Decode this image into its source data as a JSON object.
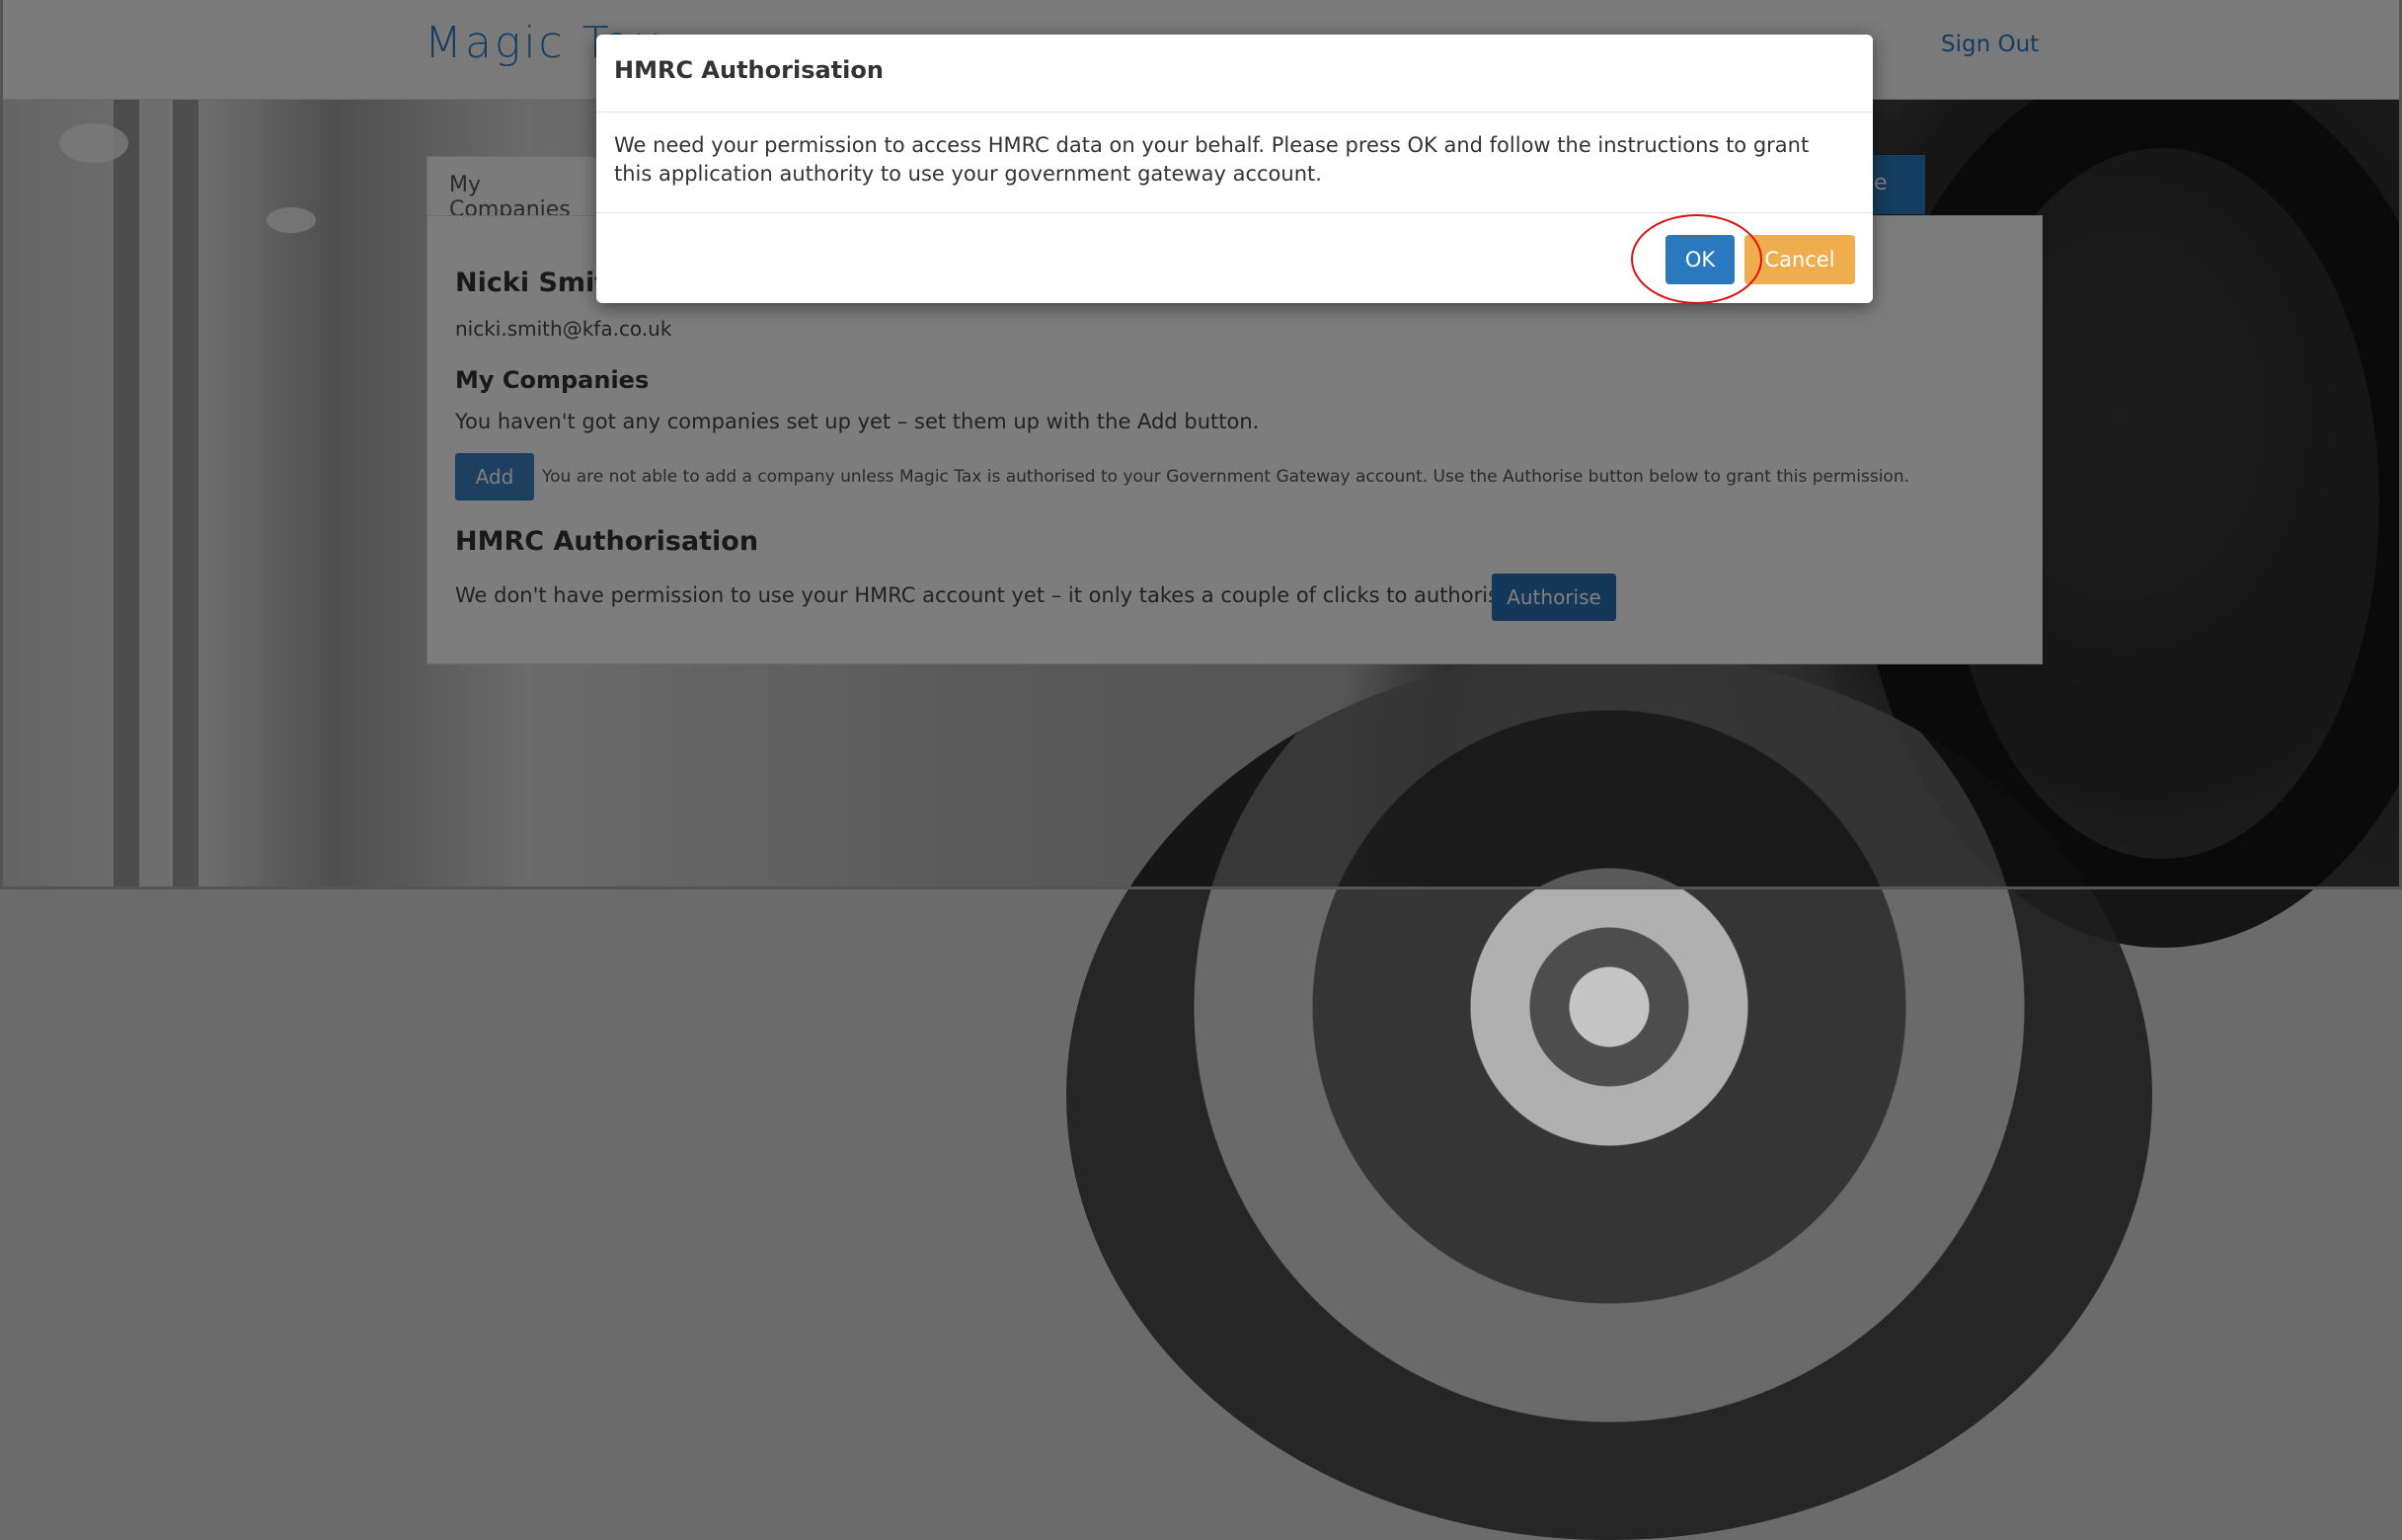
{
  "header": {
    "brand": "Magic Tax",
    "sign_out": "Sign Out"
  },
  "tabs": {
    "my_companies": "My Companies",
    "partial_blue_tab": "nce"
  },
  "profile": {
    "name": "Nicki Smith",
    "email": "nicki.smith@kfa.co.uk"
  },
  "companies": {
    "heading": "My Companies",
    "empty_text": "You haven't got any companies set up yet – set them up with the Add button.",
    "add_label": "Add",
    "add_note": "You are not able to add a company unless Magic Tax is authorised to your Government Gateway account. Use the Authorise button below to grant this permission."
  },
  "hmrc": {
    "heading": "HMRC Authorisation",
    "text": "We don't have permission to use your HMRC account yet – it only takes a couple of clicks to authorise us.",
    "authorise_label": "Authorise"
  },
  "modal": {
    "title": "HMRC Authorisation",
    "body": "We need your permission to access HMRC data on your behalf. Please press OK and follow the instructions to grant this application authority to use your government gateway account.",
    "ok_label": "OK",
    "cancel_label": "Cancel"
  },
  "colors": {
    "accent": "#2a7bbf",
    "cancel": "#f0ad4e",
    "highlight_ring": "#e01010"
  }
}
